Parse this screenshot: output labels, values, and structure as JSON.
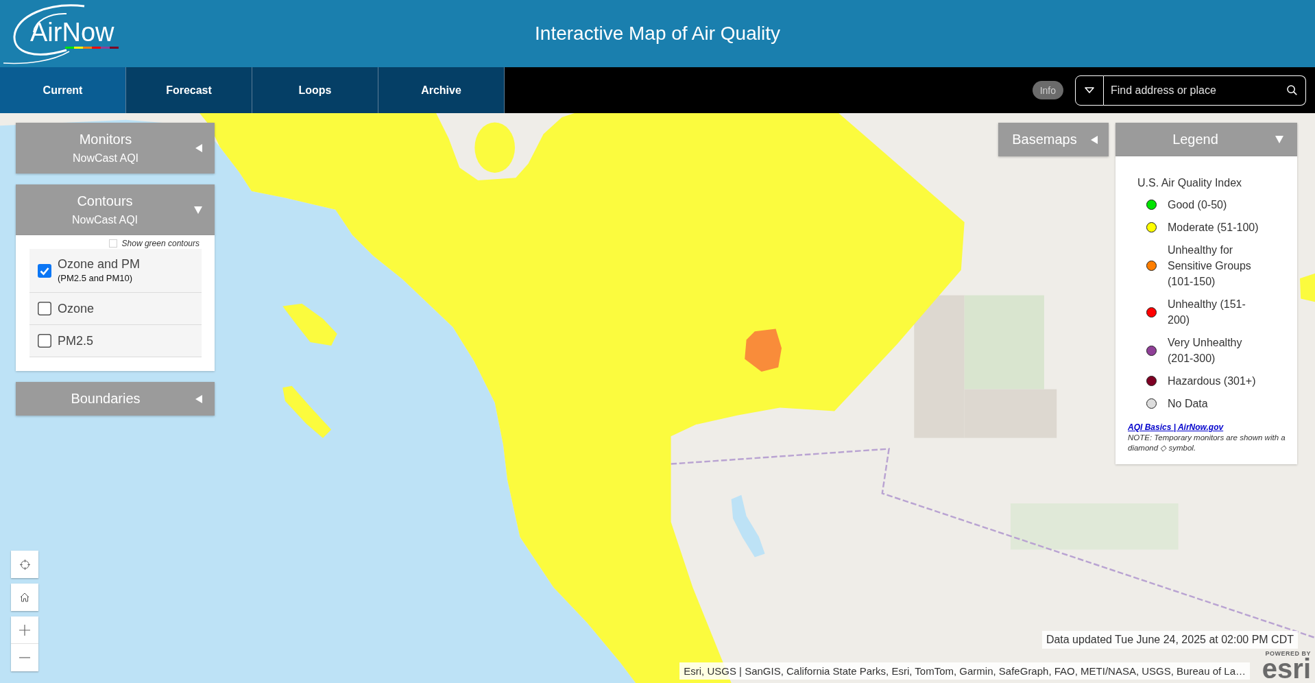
{
  "header": {
    "logo": {
      "wordmark": "AirNow"
    },
    "title": "Interactive Map of Air Quality"
  },
  "nav": {
    "tabs": [
      {
        "label": "Current",
        "selected": true
      },
      {
        "label": "Forecast",
        "selected": false
      },
      {
        "label": "Loops",
        "selected": false
      },
      {
        "label": "Archive",
        "selected": false
      }
    ],
    "info_button": "Info",
    "search": {
      "placeholder": "Find address or place"
    }
  },
  "panels": [
    {
      "title": "Monitors",
      "subtitle": "NowCast AQI",
      "expanded": false
    },
    {
      "title": "Contours",
      "subtitle": "NowCast AQI",
      "expanded": true,
      "green_contours": {
        "label": "Show green contours",
        "checked": false
      },
      "options": [
        {
          "label": "Ozone and PM",
          "note": "(PM2.5 and PM10)",
          "checked": true
        },
        {
          "label": "Ozone",
          "checked": false
        },
        {
          "label": "PM2.5",
          "checked": false
        }
      ]
    },
    {
      "title": "Boundaries",
      "expanded": false
    }
  ],
  "basemaps": {
    "title": "Basemaps",
    "expanded": false
  },
  "legend": {
    "title": "Legend",
    "expanded": true,
    "heading": "U.S. Air Quality Index",
    "items": [
      {
        "label": "Good (0-50)",
        "color": "#00e400"
      },
      {
        "label": "Moderate (51-100)",
        "color": "#ffff00"
      },
      {
        "label": "Unhealthy for Sensitive Groups (101-150)",
        "color": "#ff7e00"
      },
      {
        "label": "Unhealthy (151-200)",
        "color": "#ff0000"
      },
      {
        "label": "Very Unhealthy (201-300)",
        "color": "#8f3f97"
      },
      {
        "label": "Hazardous (301+)",
        "color": "#7e0023"
      },
      {
        "label": "No Data",
        "color": "#dddddd"
      }
    ],
    "link": "AQI Basics | AirNow.gov",
    "note": "NOTE: Temporary monitors are shown with a diamond ◇ symbol."
  },
  "data_updated": "Data updated Tue June 24, 2025 at 02:00 PM CDT",
  "attribution": "Esri, USGS | SanGIS, California State Parks, Esri, TomTom, Garmin, SafeGraph, FAO, METI/NASA, USGS, Bureau of La…",
  "esri_logo": {
    "caption": "POWERED BY",
    "wordmark": "esri"
  }
}
